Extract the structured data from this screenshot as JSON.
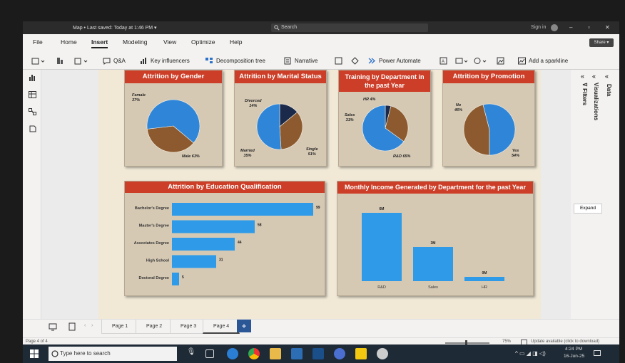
{
  "titlebar": {
    "title": "Map • Last saved: Today at 1:46 PM ▾",
    "search_placeholder": "Search",
    "signin": "Sign in"
  },
  "menu": [
    "File",
    "Home",
    "Insert",
    "Modeling",
    "View",
    "Optimize",
    "Help"
  ],
  "menu_active": "Insert",
  "share_label": "Share ▾",
  "ribbon": {
    "qa": "Q&A",
    "key_influencers": "Key influencers",
    "decomposition_tree": "Decomposition tree",
    "narrative": "Narrative",
    "power_automate": "Power Automate",
    "add_sparkline": "Add a sparkline"
  },
  "cards": {
    "gender": {
      "title": "Attrition by Gender",
      "labels": [
        "Female\n37%",
        "Male 63%"
      ],
      "values": [
        37,
        63
      ]
    },
    "marital": {
      "title": "Attrition by Marital Status",
      "labels": [
        "Divorced\n14%",
        "Married\n35%",
        "Single\n51%"
      ],
      "values": [
        14,
        35,
        51
      ]
    },
    "training": {
      "title": "Training by Department in the past Year",
      "labels": [
        "HR 4%",
        "Sales\n31%",
        "R&D 65%"
      ],
      "values": [
        4,
        31,
        65
      ]
    },
    "promotion": {
      "title": "Attrition by Promotion",
      "labels": [
        "No\n46%",
        "Yes\n54%"
      ],
      "values": [
        46,
        54
      ]
    },
    "education": {
      "title": "Attrition by Education Qualification"
    },
    "income": {
      "title": "Monthly Income Generated by Department for the past Year"
    }
  },
  "chart_data": [
    {
      "type": "pie",
      "title": "Attrition by Gender",
      "categories": [
        "Female",
        "Male"
      ],
      "values": [
        37,
        63
      ],
      "colors": [
        "#8c5a2e",
        "#2f86d8"
      ]
    },
    {
      "type": "pie",
      "title": "Attrition by Marital Status",
      "categories": [
        "Divorced",
        "Married",
        "Single"
      ],
      "values": [
        14,
        35,
        51
      ],
      "colors": [
        "#1b2a4a",
        "#8c5a2e",
        "#2f86d8"
      ]
    },
    {
      "type": "pie",
      "title": "Training by Department in the past Year",
      "categories": [
        "HR",
        "Sales",
        "R&D"
      ],
      "values": [
        4,
        31,
        65
      ],
      "colors": [
        "#1b2a4a",
        "#8c5a2e",
        "#2f86d8"
      ]
    },
    {
      "type": "pie",
      "title": "Attrition by Promotion",
      "categories": [
        "No",
        "Yes"
      ],
      "values": [
        46,
        54
      ],
      "colors": [
        "#8c5a2e",
        "#2f86d8"
      ]
    },
    {
      "type": "bar",
      "orientation": "horizontal",
      "title": "Attrition by Education Qualification",
      "categories": [
        "Bachelor's Degree",
        "Master's Degree",
        "Associates Degree",
        "High School",
        "Doctoral Degree"
      ],
      "values": [
        99,
        58,
        44,
        31,
        5
      ],
      "data_labels": [
        "99",
        "58",
        "44",
        "31",
        "5"
      ],
      "xlim": [
        0,
        100
      ],
      "color": "#2f9be8"
    },
    {
      "type": "bar",
      "title": "Monthly Income Generated by Department for the past Year",
      "categories": [
        "R&D",
        "Sales",
        "HR"
      ],
      "values": [
        6,
        3,
        0
      ],
      "data_labels": [
        "6M",
        "3M",
        "0M"
      ],
      "ylim": [
        0,
        6.5
      ],
      "color": "#2f9be8"
    }
  ],
  "right": {
    "filters": "Filters",
    "visualizations": "Visualizations",
    "data": "Data",
    "expand": "Expand"
  },
  "tabs": [
    "Page 1",
    "Page 2",
    "Page 3",
    "Page 4"
  ],
  "active_tab": "Page 4",
  "status": {
    "page": "Page 4 of 4",
    "zoom": "75%",
    "update": "Update available (click to download)"
  },
  "taskbar": {
    "search_placeholder": "Type here to search",
    "time": "4:24 PM",
    "date": "16-Jun-25"
  }
}
